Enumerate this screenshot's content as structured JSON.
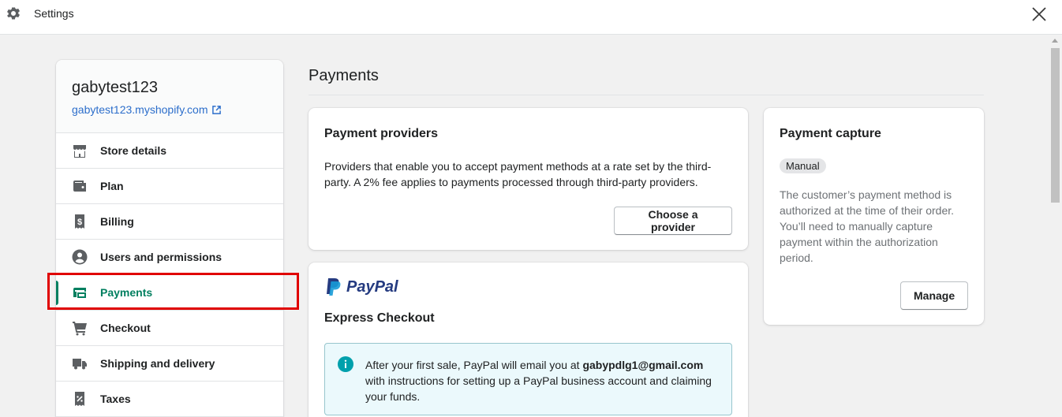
{
  "header": {
    "title": "Settings",
    "icon": "gear-icon",
    "close_icon": "close-icon"
  },
  "store": {
    "name": "gabytest123",
    "url": "gabytest123.myshopify.com"
  },
  "sidebar": {
    "items": [
      {
        "label": "Store details",
        "icon": "store-icon"
      },
      {
        "label": "Plan",
        "icon": "wallet-icon"
      },
      {
        "label": "Billing",
        "icon": "receipt-dollar-icon"
      },
      {
        "label": "Users and permissions",
        "icon": "user-circle-icon"
      },
      {
        "label": "Payments",
        "icon": "payments-icon",
        "active": true
      },
      {
        "label": "Checkout",
        "icon": "cart-icon"
      },
      {
        "label": "Shipping and delivery",
        "icon": "truck-icon"
      },
      {
        "label": "Taxes",
        "icon": "tax-receipt-icon"
      }
    ]
  },
  "main": {
    "title": "Payments",
    "providers": {
      "title": "Payment providers",
      "description": "Providers that enable you to accept payment methods at a rate set by the third-party. A 2% fee applies to payments processed through third-party providers.",
      "button": "Choose a provider"
    },
    "paypal": {
      "logo_text": "PayPal",
      "title": "Express Checkout",
      "banner_pre": "After your first sale, PayPal will email you at ",
      "banner_email": "gabypdlg1@gmail.com",
      "banner_post": " with instructions for setting up a PayPal business account and claiming your funds."
    },
    "capture": {
      "title": "Payment capture",
      "badge": "Manual",
      "description": "The customer’s payment method is authorized at the time of their order. You’ll need to manually capture payment within the authorization period.",
      "button": "Manage"
    }
  },
  "colors": {
    "accent": "#008060",
    "link": "#2c6ecb",
    "highlight": "#e00000",
    "paypal_dark": "#253b80",
    "paypal_light": "#179bd7"
  }
}
